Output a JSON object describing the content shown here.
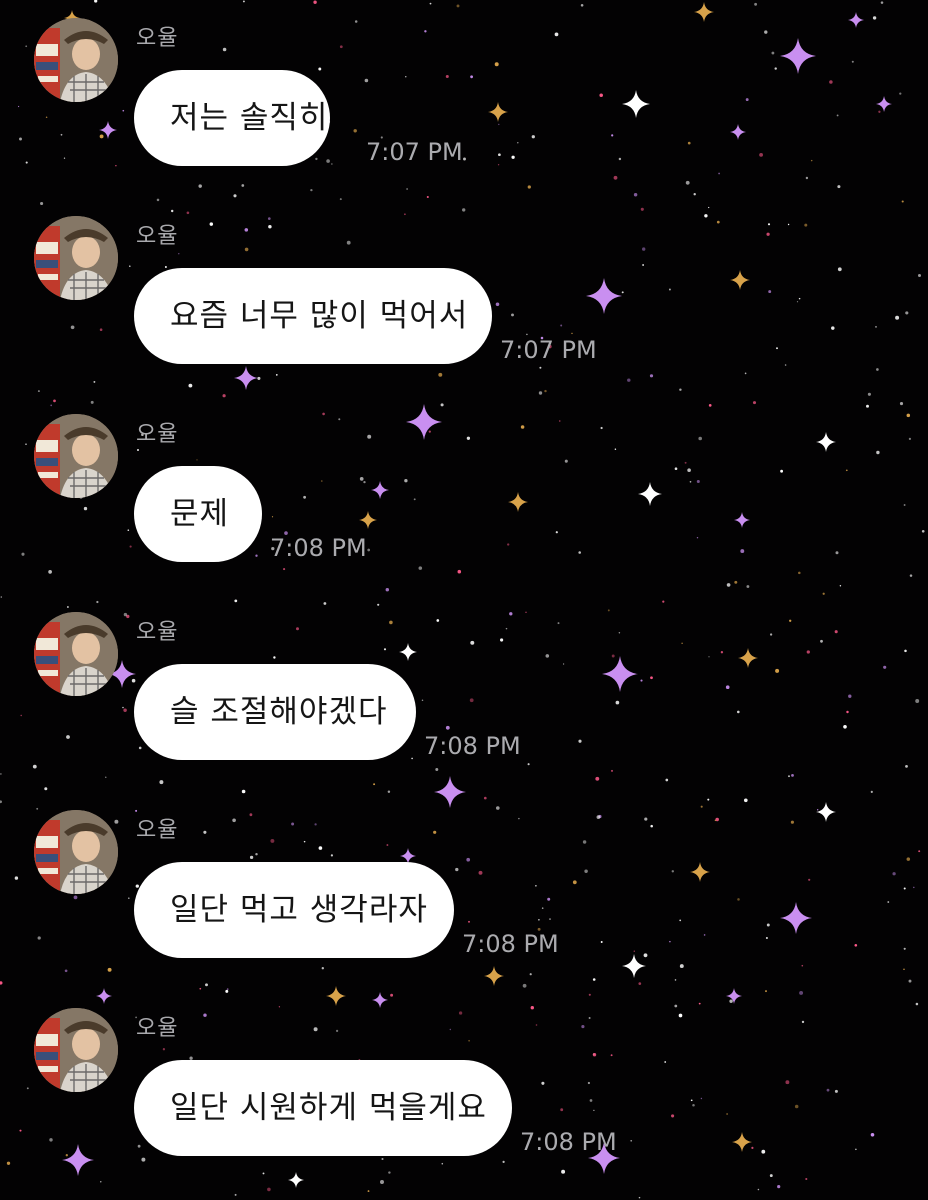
{
  "conversation": {
    "sender_name": "오율",
    "avatar_icon": "profile-photo",
    "messages": [
      {
        "text": "저는 솔직히",
        "time": "7:07 PM"
      },
      {
        "text": "요즘 너무 많이 먹어서",
        "time": "7:07 PM"
      },
      {
        "text": "문제",
        "time": "7:08 PM"
      },
      {
        "text": "슬 조절해야겠다",
        "time": "7:08 PM"
      },
      {
        "text": "일단 먹고 생각라자",
        "time": "7:08 PM"
      },
      {
        "text": "일단 시원하게 먹을게요",
        "time": "7:08 PM"
      }
    ]
  },
  "colors": {
    "background": "#030203",
    "bubble": "#ffffff",
    "bubble_text": "#151515",
    "meta_text": "#ababaf",
    "star_white": "#ffffff",
    "star_purple": "#c98ff0",
    "star_gold": "#d8a24a",
    "star_pink": "#ff5a8a"
  }
}
